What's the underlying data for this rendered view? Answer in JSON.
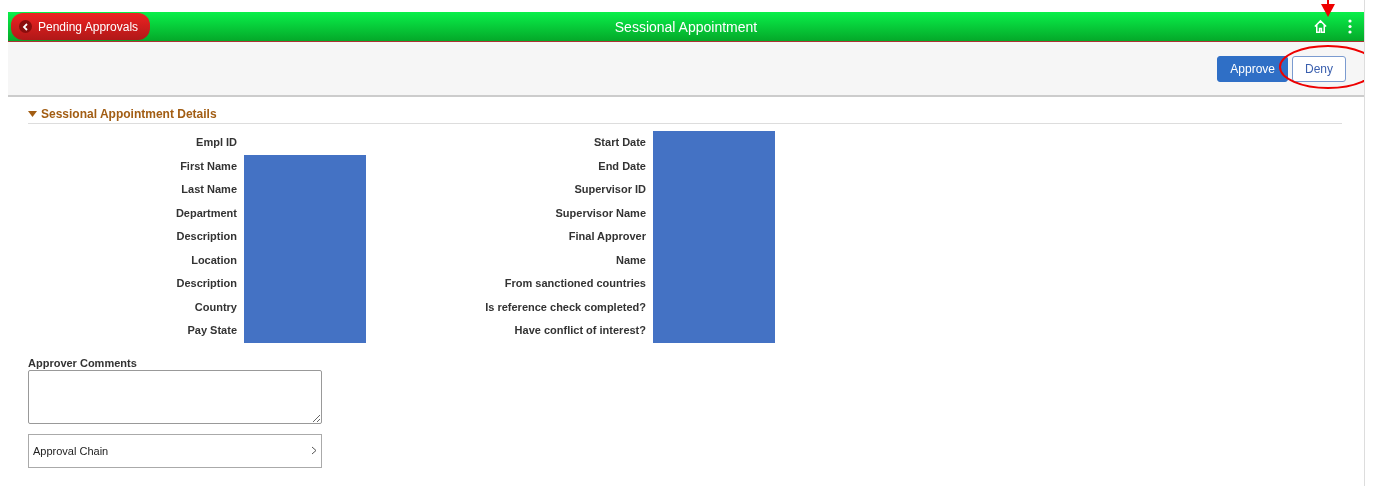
{
  "header": {
    "back_button": "Pending Approvals",
    "title": "Sessional Appointment"
  },
  "actions": [
    {
      "label": "Approve",
      "kind": "primary"
    },
    {
      "label": "Deny",
      "kind": "secondary"
    }
  ],
  "section": {
    "title": "Sessional Appointment Details",
    "expanded": true,
    "left_fields": [
      {
        "label": "Empl ID",
        "redacted": false
      },
      {
        "label": "First Name",
        "redacted": true
      },
      {
        "label": "Last Name",
        "redacted": true
      },
      {
        "label": "Department",
        "redacted": true
      },
      {
        "label": "Description",
        "redacted": true
      },
      {
        "label": "Location",
        "redacted": true
      },
      {
        "label": "Description",
        "redacted": true
      },
      {
        "label": "Country",
        "redacted": true
      },
      {
        "label": "Pay State",
        "redacted": true
      }
    ],
    "right_fields": [
      {
        "label": "Start Date",
        "redacted": true
      },
      {
        "label": "End Date",
        "redacted": true
      },
      {
        "label": "Supervisor ID",
        "redacted": true
      },
      {
        "label": "Supervisor Name",
        "redacted": true
      },
      {
        "label": "Final Approver",
        "redacted": true
      },
      {
        "label": "Name",
        "redacted": true
      },
      {
        "label": "From sanctioned countries",
        "redacted": true
      },
      {
        "label": "Is reference check completed?",
        "redacted": true
      },
      {
        "label": "Have conflict of interest?",
        "redacted": true
      }
    ]
  },
  "comments": {
    "label": "Approver Comments"
  },
  "approval_chain": {
    "label": "Approval Chain"
  },
  "annotations": {
    "arrow": true,
    "ellipse": true
  }
}
